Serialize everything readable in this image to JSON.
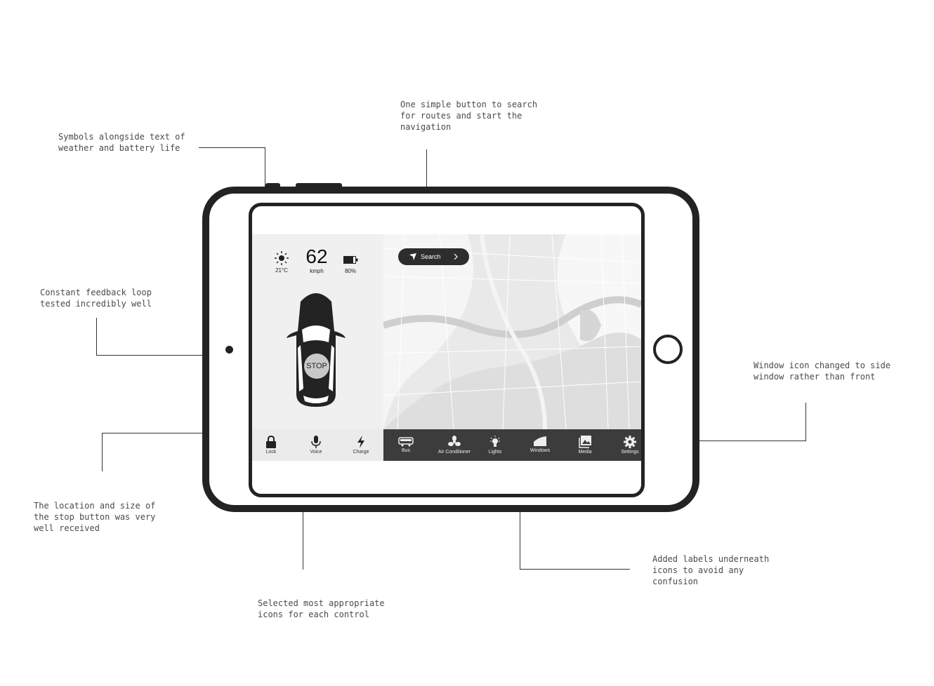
{
  "annotations": {
    "symbols": "Symbols alongside text of\nweather and battery life",
    "search": "One simple button to search\nfor routes and start the\nnavigation",
    "feedback": "Constant feedback loop\ntested incredibly well",
    "window": "Window icon changed to side\nwindow rather than front",
    "stop": "The location and size of\nthe stop button was very\nwell received",
    "icons": "Selected most appropriate\nicons for each control",
    "labels": "Added labels underneath\nicons to avoid any\nconfusion"
  },
  "dashboard": {
    "temperature": "21°C",
    "speed": "62",
    "speed_unit": "kmph",
    "battery": "80%",
    "stop_label": "STOP"
  },
  "search": {
    "label": "Search"
  },
  "controls_left": [
    {
      "label": "Lock",
      "icon": "lock-icon"
    },
    {
      "label": "Voice",
      "icon": "microphone-icon"
    },
    {
      "label": "Charge",
      "icon": "lightning-icon"
    }
  ],
  "controls_right": [
    {
      "label": "Bus",
      "icon": "bus-icon"
    },
    {
      "label": "Air Conditioner",
      "icon": "fan-icon"
    },
    {
      "label": "Lights",
      "icon": "lightbulb-icon"
    },
    {
      "label": "Windows",
      "icon": "side-window-icon"
    },
    {
      "label": "Media",
      "icon": "image-icon"
    },
    {
      "label": "Settings",
      "icon": "gear-icon"
    }
  ],
  "colors": {
    "device": "#232323",
    "control_bar_dark": "#3c3c3c",
    "map_background": "#e9e9e9"
  }
}
